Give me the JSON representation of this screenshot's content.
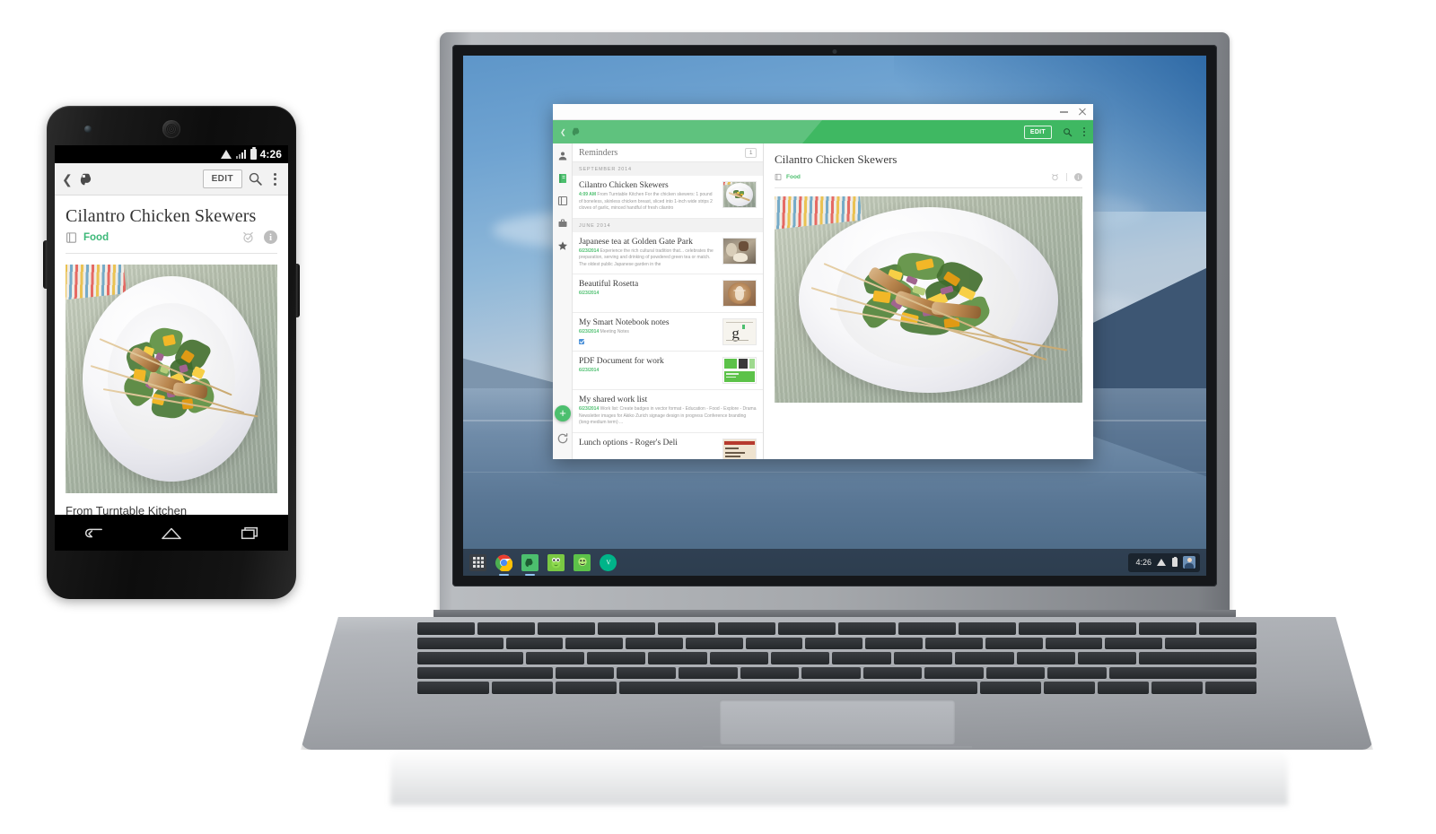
{
  "phone": {
    "statusbar": {
      "time": "4:26",
      "icons": [
        "wifi-icon",
        "signal-icon",
        "battery-icon"
      ]
    },
    "appbar": {
      "back_icon": "chevron-left-icon",
      "logo": "evernote-logo",
      "edit_label": "EDIT",
      "search_icon": "search-icon",
      "overflow_icon": "kebab-menu-icon"
    },
    "note": {
      "title": "Cilantro Chicken Skewers",
      "notebook": "Food",
      "notebook_icon": "notebook-icon",
      "reminder_icon": "alarm-clock-icon",
      "info_icon": "info-icon",
      "info_glyph": "i",
      "caption": "From Turntable Kitchen"
    },
    "navbar": {
      "back": "back-icon",
      "home": "home-icon",
      "recents": "recents-icon"
    }
  },
  "laptop": {
    "window": {
      "minimize_icon": "minimize-icon",
      "close_icon": "close-icon",
      "appbar": {
        "back_icon": "chevron-left-icon",
        "logo": "evernote-logo",
        "edit_label": "EDIT",
        "search_icon": "search-icon",
        "overflow_icon": "kebab-menu-icon"
      },
      "rail_icons": [
        "account-icon",
        "notes-icon",
        "notebooks-icon",
        "business-icon",
        "shortcuts-icon"
      ],
      "fab_label": "+",
      "sync_icon": "sync-icon",
      "list": {
        "header": "Reminders",
        "badge": "1",
        "sections": [
          {
            "label": "SEPTEMBER 2014",
            "notes": [
              {
                "title": "Cilantro Chicken Skewers",
                "date": "4:09 AM",
                "snippet": "From Turntable Kitchen For the chicken skewers: 1 pound of boneless, skinless chicken breast, sliced into 1-inch wide strips 2 cloves of garlic, minced handful of fresh cilantro",
                "thumb": "food-photo"
              }
            ]
          },
          {
            "label": "JUNE 2014",
            "notes": [
              {
                "title": "Japanese tea at Golden Gate Park",
                "date": "6/23/2014",
                "snippet": "Experience the rich cultural tradition that... celebrates the preparation, serving and drinking of powdered green tea or match. The oldest public Japanese garden in the",
                "thumb": "tea-photo"
              },
              {
                "title": "Beautiful Rosetta",
                "date": "6/23/2014",
                "snippet": "",
                "thumb": "latte-photo"
              },
              {
                "title": "My Smart Notebook notes",
                "date": "6/23/2014",
                "snippet": "Meeting Notes",
                "thumb": "document-photo",
                "checkbox": true
              },
              {
                "title": "PDF Document for work",
                "date": "6/23/2014",
                "snippet": "",
                "thumb": "pdf-photo"
              },
              {
                "title": "My shared work list",
                "date": "6/23/2014",
                "snippet": "Work list:   Create badges in vector format   - Education   - Food   - Explore   - Drama   Newsletter images for Akiko   Zurich signage design in progress   Conference branding (long-medium term)   ...",
                "thumb": ""
              },
              {
                "title": "Lunch options - Roger's Deli",
                "date": "",
                "snippet": "",
                "thumb": "menu-photo"
              }
            ]
          }
        ]
      },
      "detail": {
        "title": "Cilantro Chicken Skewers",
        "notebook": "Food",
        "notebook_icon": "notebook-icon",
        "reminder_icon": "alarm-clock-icon",
        "info_icon": "info-icon",
        "info_glyph": "i"
      }
    },
    "shelf": {
      "apps": [
        {
          "name": "launcher-icon",
          "color": "#3a3f45"
        },
        {
          "name": "chrome-icon",
          "color": "#f1f1f1"
        },
        {
          "name": "evernote-icon",
          "color": "#4cbf6e"
        },
        {
          "name": "duolingo-icon",
          "color": "#7ac943"
        },
        {
          "name": "green-app-icon",
          "color": "#5cc249"
        },
        {
          "name": "vine-icon",
          "color": "#00b489"
        }
      ],
      "tray": {
        "time": "4:26",
        "wifi_icon": "wifi-icon",
        "battery_icon": "battery-icon",
        "avatar": "user-avatar"
      }
    }
  },
  "colors": {
    "evernote_green": "#4cbf6e",
    "appbar_light": "#5fc27e",
    "appbar_dark": "#3fb862",
    "wallpaper_sky": "#6fa3d1",
    "wallpaper_water": "#5a7795"
  }
}
